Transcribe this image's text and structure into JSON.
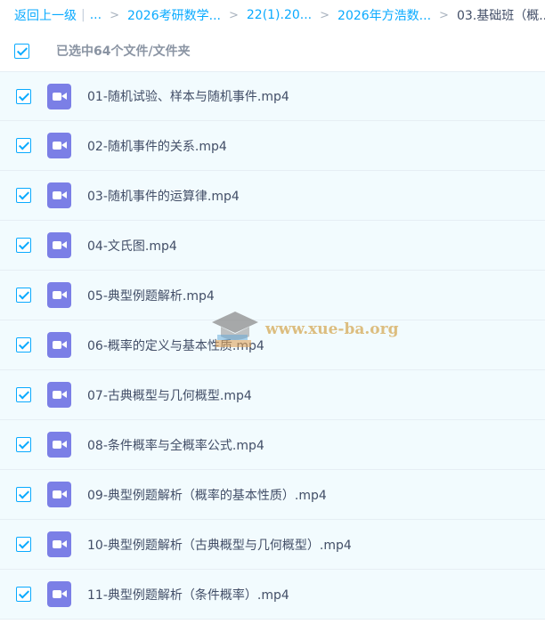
{
  "breadcrumb": {
    "back": "返回上一级",
    "ellipsis": "...",
    "items": [
      "2026考研数学...",
      "22(1).20...",
      "2026年方浩数...",
      "03.基础班（概..."
    ]
  },
  "selection": {
    "summary": "已选中64个文件/文件夹"
  },
  "files": [
    {
      "name": "01-随机试验、样本与随机事件.mp4",
      "icon": "video-icon",
      "checked": true
    },
    {
      "name": "02-随机事件的关系.mp4",
      "icon": "video-icon",
      "checked": true
    },
    {
      "name": "03-随机事件的运算律.mp4",
      "icon": "video-icon",
      "checked": true
    },
    {
      "name": "04-文氏图.mp4",
      "icon": "video-icon",
      "checked": true
    },
    {
      "name": "05-典型例题解析.mp4",
      "icon": "video-icon",
      "checked": true
    },
    {
      "name": "06-概率的定义与基本性质.mp4",
      "icon": "video-icon",
      "checked": true
    },
    {
      "name": "07-古典概型与几何概型.mp4",
      "icon": "video-icon",
      "checked": true
    },
    {
      "name": "08-条件概率与全概率公式.mp4",
      "icon": "video-icon",
      "checked": true
    },
    {
      "name": "09-典型例题解析（概率的基本性质）.mp4",
      "icon": "video-icon",
      "checked": true
    },
    {
      "name": "10-典型例题解析（古典概型与几何概型）.mp4",
      "icon": "video-icon",
      "checked": true
    },
    {
      "name": "11-典型例题解析（条件概率）.mp4",
      "icon": "video-icon",
      "checked": true
    }
  ],
  "watermark": {
    "text": "www.xue-ba.org"
  },
  "colors": {
    "accent": "#09aaff",
    "row_background": "#f2fbfe",
    "video_icon": "#7b7fe6",
    "text": "#424e67",
    "watermark": "#d9b36a"
  }
}
